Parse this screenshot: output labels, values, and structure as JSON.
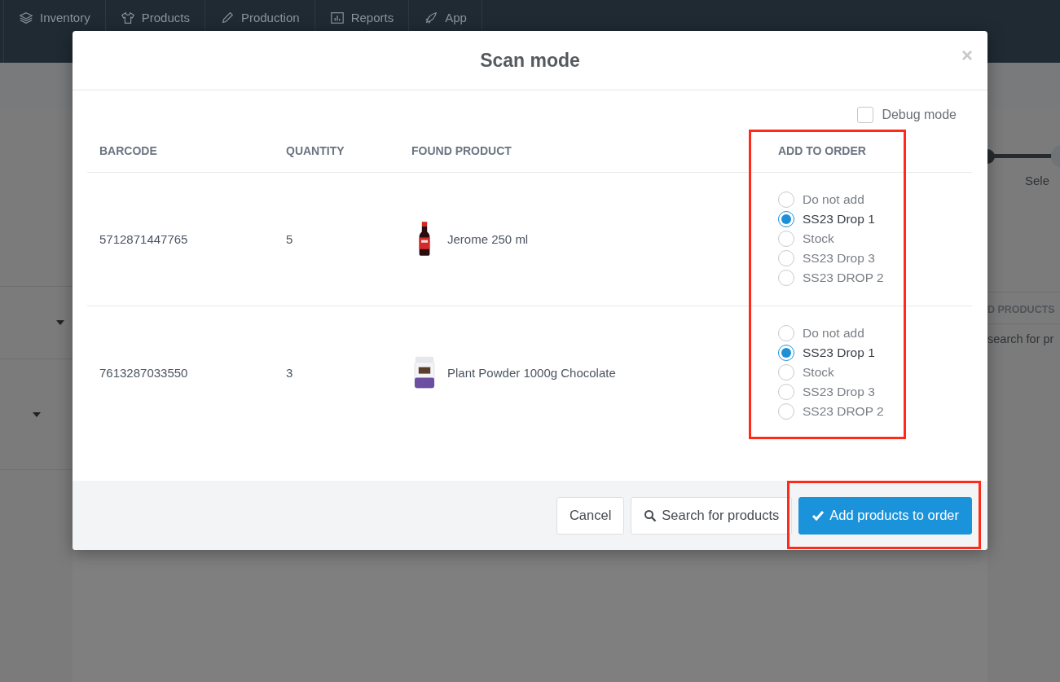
{
  "nav": [
    {
      "label": "Inventory"
    },
    {
      "label": "Products"
    },
    {
      "label": "Production"
    },
    {
      "label": "Reports"
    },
    {
      "label": "App"
    }
  ],
  "background": {
    "step_label": "Sele",
    "section_header": "D PRODUCTS",
    "search_placeholder": "search for pr"
  },
  "modal": {
    "title": "Scan mode",
    "close": "×",
    "debug_mode": {
      "label": "Debug mode",
      "checked": false
    },
    "table": {
      "columns": [
        "BARCODE",
        "QUANTITY",
        "FOUND PRODUCT",
        "ADD TO ORDER"
      ],
      "rows": [
        {
          "barcode": "5712871447765",
          "quantity": "5",
          "product": {
            "name": "Jerome 250 ml",
            "kind": "bottle"
          },
          "options": [
            {
              "label": "Do not add",
              "selected": false
            },
            {
              "label": "SS23 Drop 1",
              "selected": true
            },
            {
              "label": "Stock",
              "selected": false
            },
            {
              "label": "SS23 Drop 3",
              "selected": false
            },
            {
              "label": "SS23 DROP 2",
              "selected": false
            }
          ]
        },
        {
          "barcode": "7613287033550",
          "quantity": "3",
          "product": {
            "name": "Plant Powder 1000g Chocolate",
            "kind": "jar"
          },
          "options": [
            {
              "label": "Do not add",
              "selected": false
            },
            {
              "label": "SS23 Drop 1",
              "selected": true
            },
            {
              "label": "Stock",
              "selected": false
            },
            {
              "label": "SS23 Drop 3",
              "selected": false
            },
            {
              "label": "SS23 DROP 2",
              "selected": false
            }
          ]
        }
      ]
    },
    "buttons": [
      {
        "label": "Cancel",
        "kind": "default"
      },
      {
        "label": "Search for products",
        "kind": "search"
      },
      {
        "label": "Add products to order",
        "kind": "primary"
      }
    ]
  }
}
